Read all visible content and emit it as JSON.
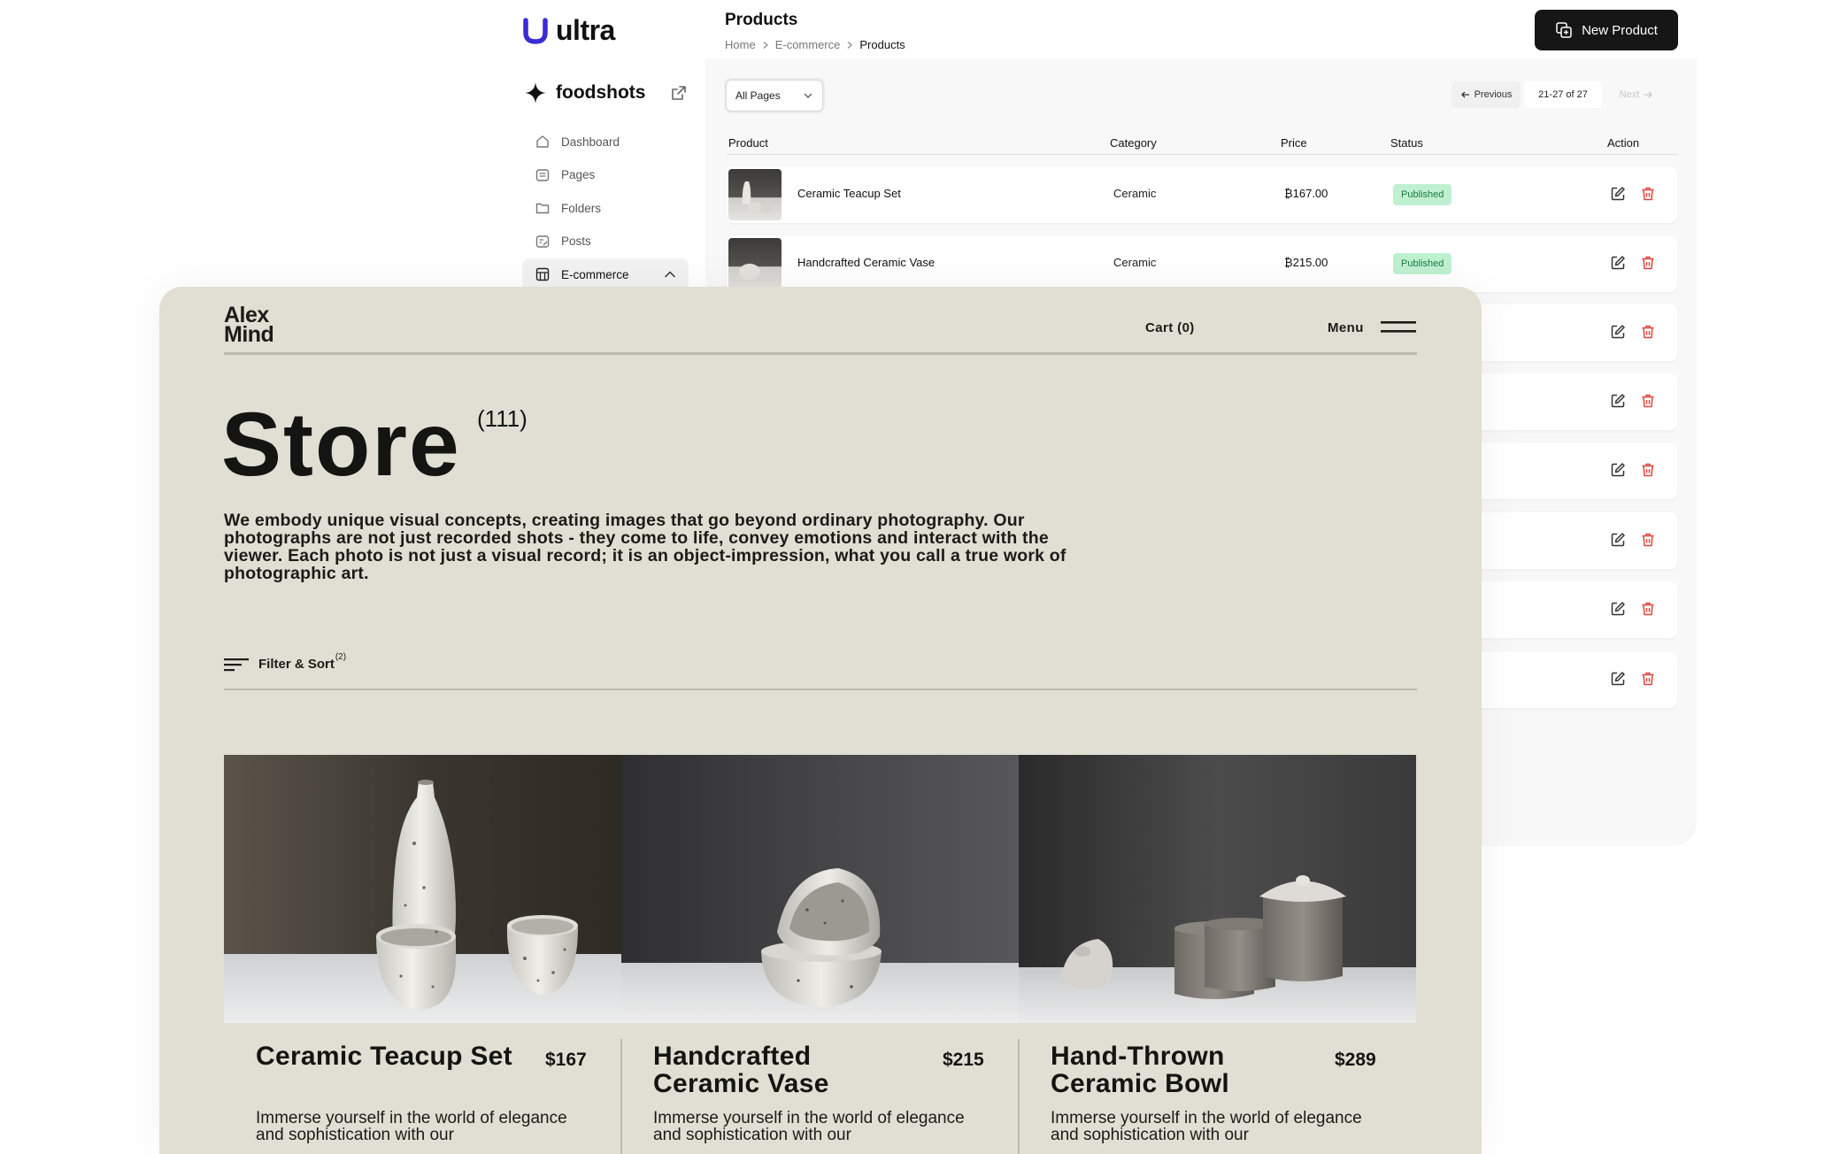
{
  "admin": {
    "logo_text": "ultra",
    "site_name": "foodshots",
    "nav": [
      {
        "label": "Dashboard",
        "icon": "home-icon"
      },
      {
        "label": "Pages",
        "icon": "pages-icon"
      },
      {
        "label": "Folders",
        "icon": "folder-icon"
      },
      {
        "label": "Posts",
        "icon": "posts-icon"
      },
      {
        "label": "E-commerce",
        "icon": "store-icon",
        "active": true
      }
    ],
    "page_title": "Products",
    "breadcrumb": [
      "Home",
      "E-commerce",
      "Products"
    ],
    "new_button": "New Product",
    "filter_select": "All Pages",
    "pager": {
      "prev": "Previous",
      "info": "21-27 of 27",
      "next": "Next"
    },
    "table": {
      "headers": {
        "product": "Product",
        "category": "Category",
        "price": "Price",
        "status": "Status",
        "action": "Action"
      },
      "rows": [
        {
          "product": "Ceramic Teacup Set",
          "category": "Ceramic",
          "price": "₿167.00",
          "status": "Published"
        },
        {
          "product": "Handcrafted Ceramic Vase",
          "category": "Ceramic",
          "price": "₿215.00",
          "status": "Published"
        }
      ]
    },
    "colors": {
      "accent": "#3b2bd6",
      "badge_bg": "#bff1d1",
      "badge_text": "#1d7a43",
      "delete": "#e0443b"
    }
  },
  "store": {
    "brand": "Alex\nMind",
    "cart": "Cart (0)",
    "menu": "Menu",
    "title": "Store",
    "count": "(111)",
    "description": "We embody unique visual concepts, creating images that go beyond ordinary photography. Our photographs are not just recorded shots - they come to life, convey emotions and interact with the viewer. Each photo is not just a visual record; it is an object-impression, what you call a true work of photographic art.",
    "filter_label": "Filter & Sort",
    "filter_count": "(2)",
    "products": [
      {
        "name": "Ceramic Teacup Set",
        "price": "$167",
        "desc": "Immerse yourself in the world of elegance and sophistication with our"
      },
      {
        "name": "Handcrafted Ceramic Vase",
        "price": "$215",
        "desc": "Immerse yourself in the world of elegance and sophistication with our"
      },
      {
        "name": "Hand-Thrown Ceramic Bowl",
        "price": "$289",
        "desc": "Immerse yourself in the world of elegance and sophistication with our"
      }
    ],
    "colors": {
      "background": "#e1dfd3",
      "text": "#141412"
    }
  }
}
